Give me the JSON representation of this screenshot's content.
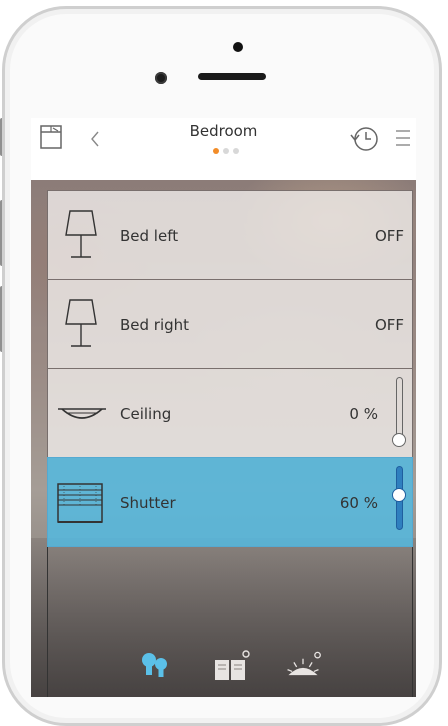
{
  "header": {
    "title": "Bedroom",
    "page_dots": [
      true,
      false,
      false
    ]
  },
  "rows": [
    {
      "label": "Bed left",
      "value": "OFF",
      "icon": "table-lamp-icon",
      "type": "switch"
    },
    {
      "label": "Bed right",
      "value": "OFF",
      "icon": "table-lamp-icon",
      "type": "switch"
    },
    {
      "label": "Ceiling",
      "value": "0 %",
      "icon": "ceiling-light-icon",
      "type": "dimmer",
      "level": 0
    },
    {
      "label": "Shutter",
      "value": "60 %",
      "icon": "shutter-icon",
      "type": "shutter",
      "level": 0.6
    }
  ],
  "bottom_tabs": [
    {
      "name": "lights-tab",
      "icon": "bulbs-icon"
    },
    {
      "name": "scenes-tab",
      "icon": "book-icon"
    },
    {
      "name": "sunrise-tab",
      "icon": "sunrise-icon"
    }
  ],
  "colors": {
    "accent": "#f28c28",
    "active_row": "#54bae0",
    "active_tab": "#5bc0e8"
  }
}
